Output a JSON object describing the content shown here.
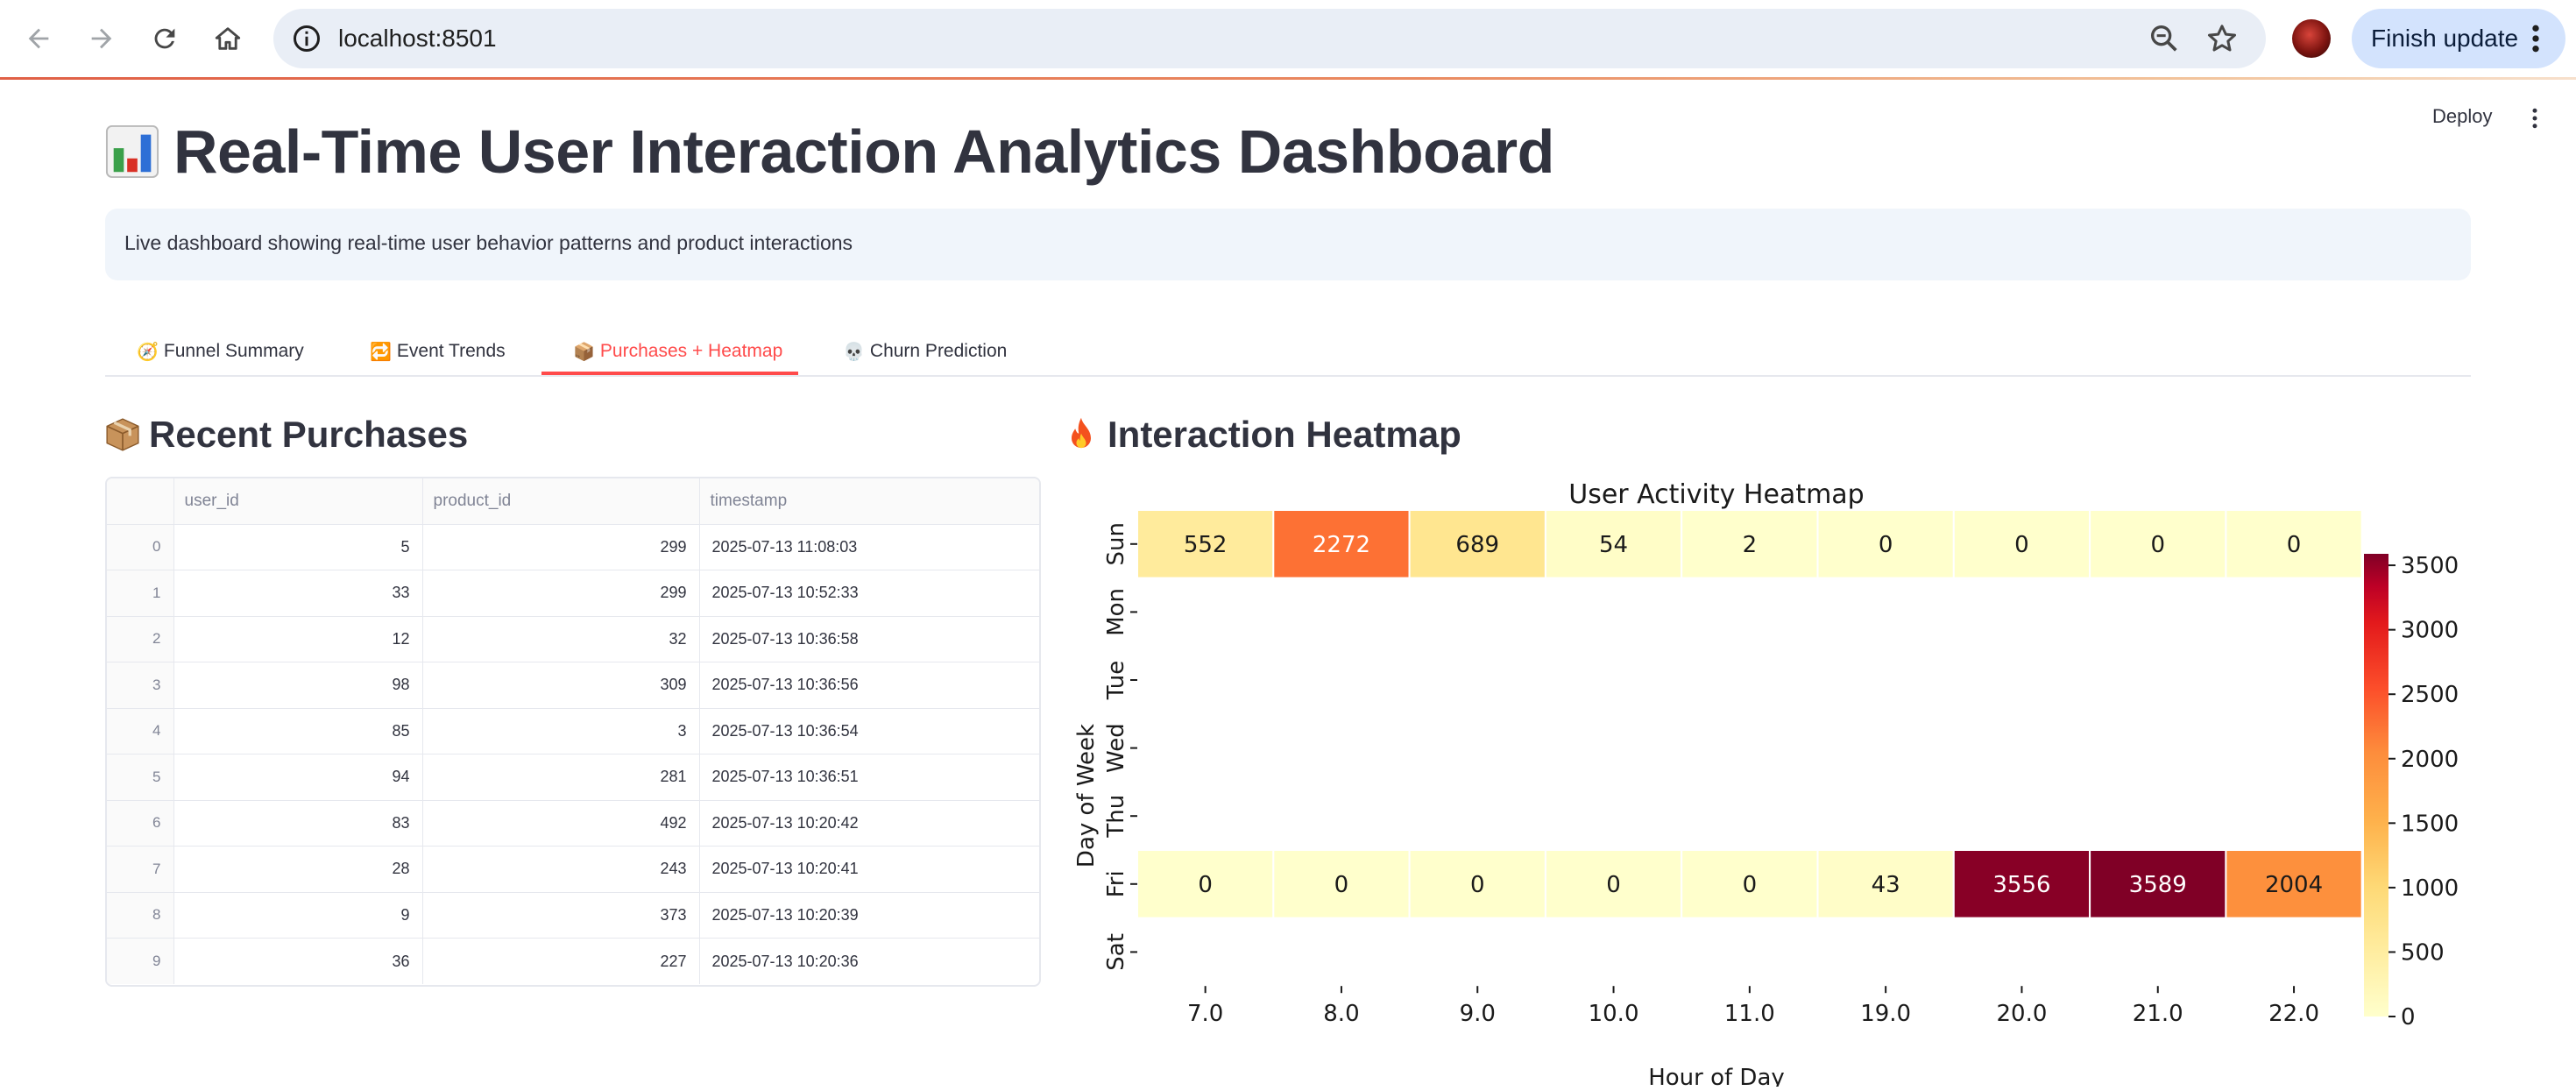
{
  "browser": {
    "url": "localhost:8501",
    "finish_update_label": "Finish update"
  },
  "header": {
    "deploy_label": "Deploy"
  },
  "page": {
    "title": "Real-Time User Interaction Analytics Dashboard",
    "description": "Live dashboard showing real-time user behavior patterns and product interactions"
  },
  "tabs": [
    {
      "icon": "🧭",
      "label": "Funnel Summary"
    },
    {
      "icon": "🔁",
      "label": "Event Trends"
    },
    {
      "icon": "📦",
      "label": "Purchases + Heatmap"
    },
    {
      "icon": "💀",
      "label": "Churn Prediction"
    }
  ],
  "recent_purchases": {
    "heading": "Recent Purchases",
    "columns": [
      "",
      "user_id",
      "product_id",
      "timestamp"
    ],
    "rows": [
      {
        "index": "0",
        "user_id": "5",
        "product_id": "299",
        "timestamp": "2025-07-13 11:08:03"
      },
      {
        "index": "1",
        "user_id": "33",
        "product_id": "299",
        "timestamp": "2025-07-13 10:52:33"
      },
      {
        "index": "2",
        "user_id": "12",
        "product_id": "32",
        "timestamp": "2025-07-13 10:36:58"
      },
      {
        "index": "3",
        "user_id": "98",
        "product_id": "309",
        "timestamp": "2025-07-13 10:36:56"
      },
      {
        "index": "4",
        "user_id": "85",
        "product_id": "3",
        "timestamp": "2025-07-13 10:36:54"
      },
      {
        "index": "5",
        "user_id": "94",
        "product_id": "281",
        "timestamp": "2025-07-13 10:36:51"
      },
      {
        "index": "6",
        "user_id": "83",
        "product_id": "492",
        "timestamp": "2025-07-13 10:20:42"
      },
      {
        "index": "7",
        "user_id": "28",
        "product_id": "243",
        "timestamp": "2025-07-13 10:20:41"
      },
      {
        "index": "8",
        "user_id": "9",
        "product_id": "373",
        "timestamp": "2025-07-13 10:20:39"
      },
      {
        "index": "9",
        "user_id": "36",
        "product_id": "227",
        "timestamp": "2025-07-13 10:20:36"
      }
    ]
  },
  "interaction_heatmap": {
    "heading": "Interaction Heatmap"
  },
  "chart_data": {
    "type": "heatmap",
    "title": "User Activity Heatmap",
    "xlabel": "Hour of Day",
    "ylabel": "Day of Week",
    "x": [
      "7.0",
      "8.0",
      "9.0",
      "10.0",
      "11.0",
      "19.0",
      "20.0",
      "21.0",
      "22.0"
    ],
    "y": [
      "Sun",
      "Mon",
      "Tue",
      "Wed",
      "Thu",
      "Fri",
      "Sat"
    ],
    "values": [
      [
        552,
        2272,
        689,
        54,
        2,
        0,
        0,
        0,
        0
      ],
      [
        null,
        null,
        null,
        null,
        null,
        null,
        null,
        null,
        null
      ],
      [
        null,
        null,
        null,
        null,
        null,
        null,
        null,
        null,
        null
      ],
      [
        null,
        null,
        null,
        null,
        null,
        null,
        null,
        null,
        null
      ],
      [
        null,
        null,
        null,
        null,
        null,
        null,
        null,
        null,
        null
      ],
      [
        0,
        0,
        0,
        0,
        0,
        43,
        3556,
        3589,
        2004
      ],
      [
        null,
        null,
        null,
        null,
        null,
        null,
        null,
        null,
        null
      ]
    ],
    "colorscale": "YlOrRd",
    "colorbar_range": [
      0,
      3589
    ],
    "colorbar_ticks": [
      0,
      500,
      1000,
      1500,
      2000,
      2500,
      3000,
      3500
    ]
  }
}
